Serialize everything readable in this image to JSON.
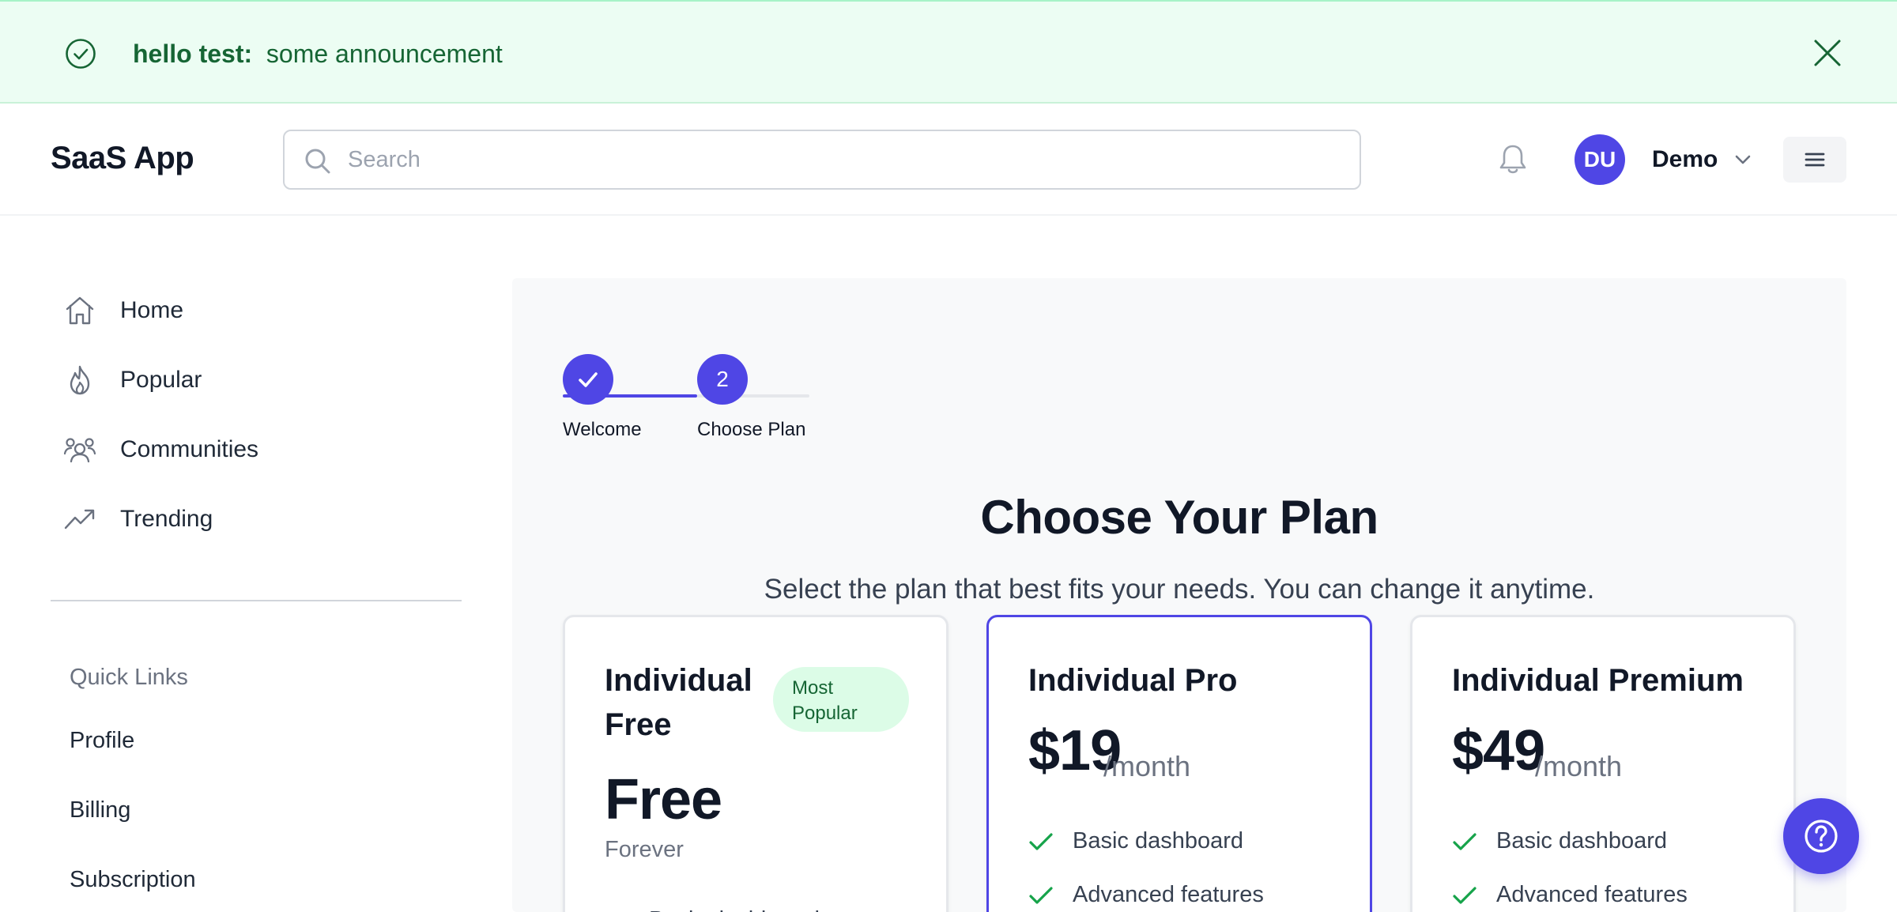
{
  "banner": {
    "title": "hello test:",
    "message": "some announcement"
  },
  "header": {
    "logo": "SaaS App",
    "search_placeholder": "Search",
    "user_initials": "DU",
    "user_name": "Demo"
  },
  "sidebar": {
    "nav": [
      {
        "label": "Home",
        "icon": "home-icon"
      },
      {
        "label": "Popular",
        "icon": "flame-icon"
      },
      {
        "label": "Communities",
        "icon": "users-icon"
      },
      {
        "label": "Trending",
        "icon": "trending-icon"
      }
    ],
    "quick_links_title": "Quick Links",
    "quick_links": [
      "Profile",
      "Billing",
      "Subscription"
    ]
  },
  "stepper": {
    "steps": [
      {
        "label": "Welcome",
        "status": "complete"
      },
      {
        "label": "Choose Plan",
        "number": "2",
        "status": "current"
      }
    ]
  },
  "plans": {
    "title": "Choose Your Plan",
    "subtitle": "Select the plan that best fits your needs. You can change it anytime.",
    "cards": [
      {
        "name_line1": "Individual",
        "name_line2": "Free",
        "badge_line1": "Most",
        "badge_line2": "Popular",
        "price": "Free",
        "period": "Forever",
        "features": [
          "Basic dashboard"
        ]
      },
      {
        "name": "Individual Pro",
        "price": "$19",
        "period": "/month",
        "features": [
          "Basic dashboard",
          "Advanced features"
        ],
        "featured": true
      },
      {
        "name": "Individual Premium",
        "price": "$49",
        "period": "/month",
        "features": [
          "Basic dashboard",
          "Advanced features"
        ]
      }
    ]
  },
  "colors": {
    "accent": "#4f46e5",
    "success": "#166534",
    "banner_bg": "#ecfdf3",
    "check": "#16a34a"
  }
}
